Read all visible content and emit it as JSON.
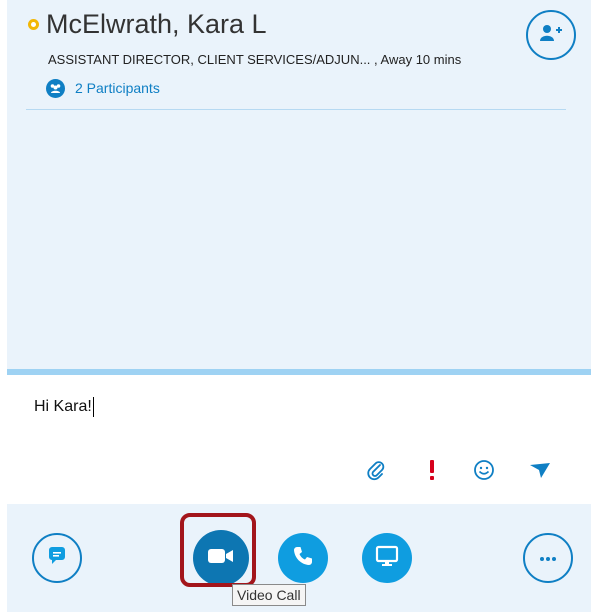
{
  "contact": {
    "name": "McElwrath, Kara L",
    "title": "ASSISTANT DIRECTOR, CLIENT SERVICES/ADJUN... ,  Away 10 mins",
    "status": "away",
    "status_color": "#f2b705"
  },
  "participants": {
    "label": "2 Participants"
  },
  "compose": {
    "text": "Hi Kara!"
  },
  "compose_tools": [
    "paperclip-icon",
    "important-icon",
    "emoji-icon",
    "send-icon"
  ],
  "call_bar": {
    "buttons": [
      "chat-icon",
      "video-icon",
      "phone-icon",
      "screen-share-icon",
      "more-icon"
    ],
    "tooltip": "Video Call"
  },
  "colors": {
    "accent": "#0f7fc4",
    "accent_fill": "#0f9de0",
    "pane_background": "#eaf3fb",
    "highlight": "#a3151b",
    "important": "#d6001c"
  }
}
